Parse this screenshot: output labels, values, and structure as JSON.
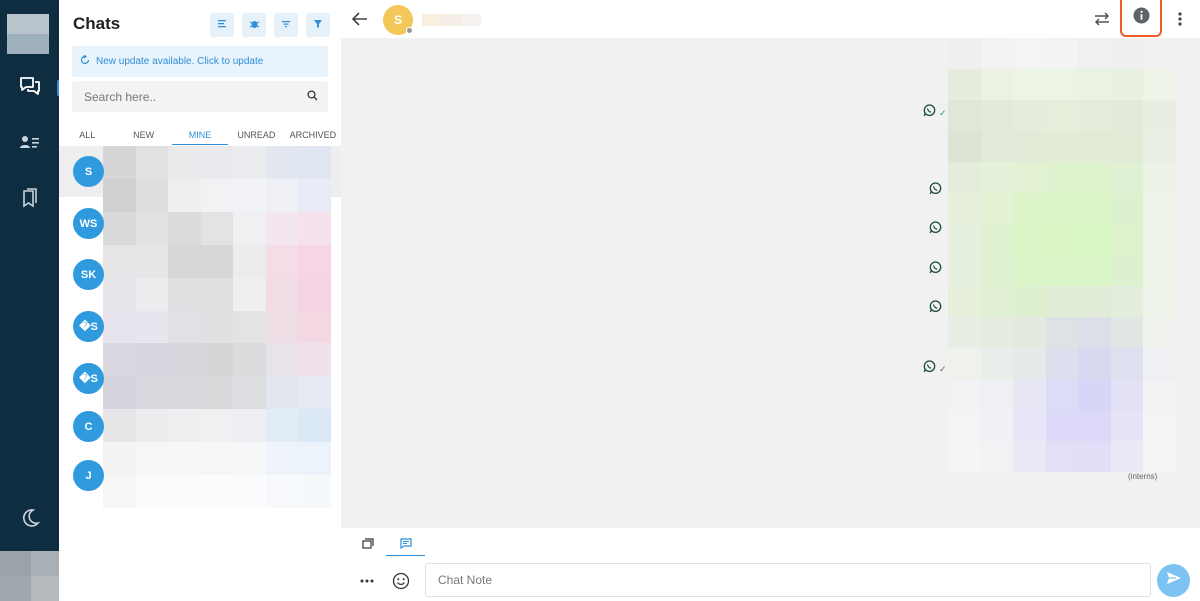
{
  "sidebar": {
    "title": "Chats",
    "update_banner": "New update available. Click to update",
    "search_placeholder": "Search here..",
    "tabs": [
      {
        "label": "ALL",
        "active": false
      },
      {
        "label": "NEW",
        "active": false
      },
      {
        "label": "MINE",
        "active": true
      },
      {
        "label": "UNREAD",
        "active": false
      },
      {
        "label": "ARCHIVED",
        "active": false
      }
    ],
    "conversations": [
      {
        "initials": "S",
        "selected": true
      },
      {
        "initials": "WS",
        "selected": false
      },
      {
        "initials": "SK",
        "selected": false
      },
      {
        "initials": "�S",
        "selected": false
      },
      {
        "initials": "�S",
        "selected": false
      },
      {
        "initials": "C",
        "selected": false
      },
      {
        "initials": "J",
        "selected": false
      }
    ]
  },
  "chat": {
    "contact_initial": "S",
    "footer_label": "(interns)",
    "composer_placeholder": "Chat Note"
  },
  "colors": {
    "nav_bg": "#0f2d40",
    "accent": "#2f8fd8",
    "avatar_blue": "#2f9bde",
    "contact_avatar": "#f3c75a",
    "highlight_border": "#f05a28",
    "whatsapp_green": "#25a954",
    "send_button": "#7cc2f2"
  },
  "icons": {
    "rail": [
      "chat-bubbles-icon",
      "contacts-icon",
      "bookmarks-icon",
      "moon-icon"
    ],
    "header": [
      "list-icon",
      "bug-icon",
      "sort-icon",
      "filter-icon"
    ],
    "chat_header": [
      "back-arrow-icon",
      "transfer-icon",
      "info-icon",
      "kebab-icon"
    ],
    "composer": [
      "reply-tab-icon",
      "note-tab-icon",
      "more-icon",
      "emoji-icon",
      "send-icon"
    ]
  }
}
